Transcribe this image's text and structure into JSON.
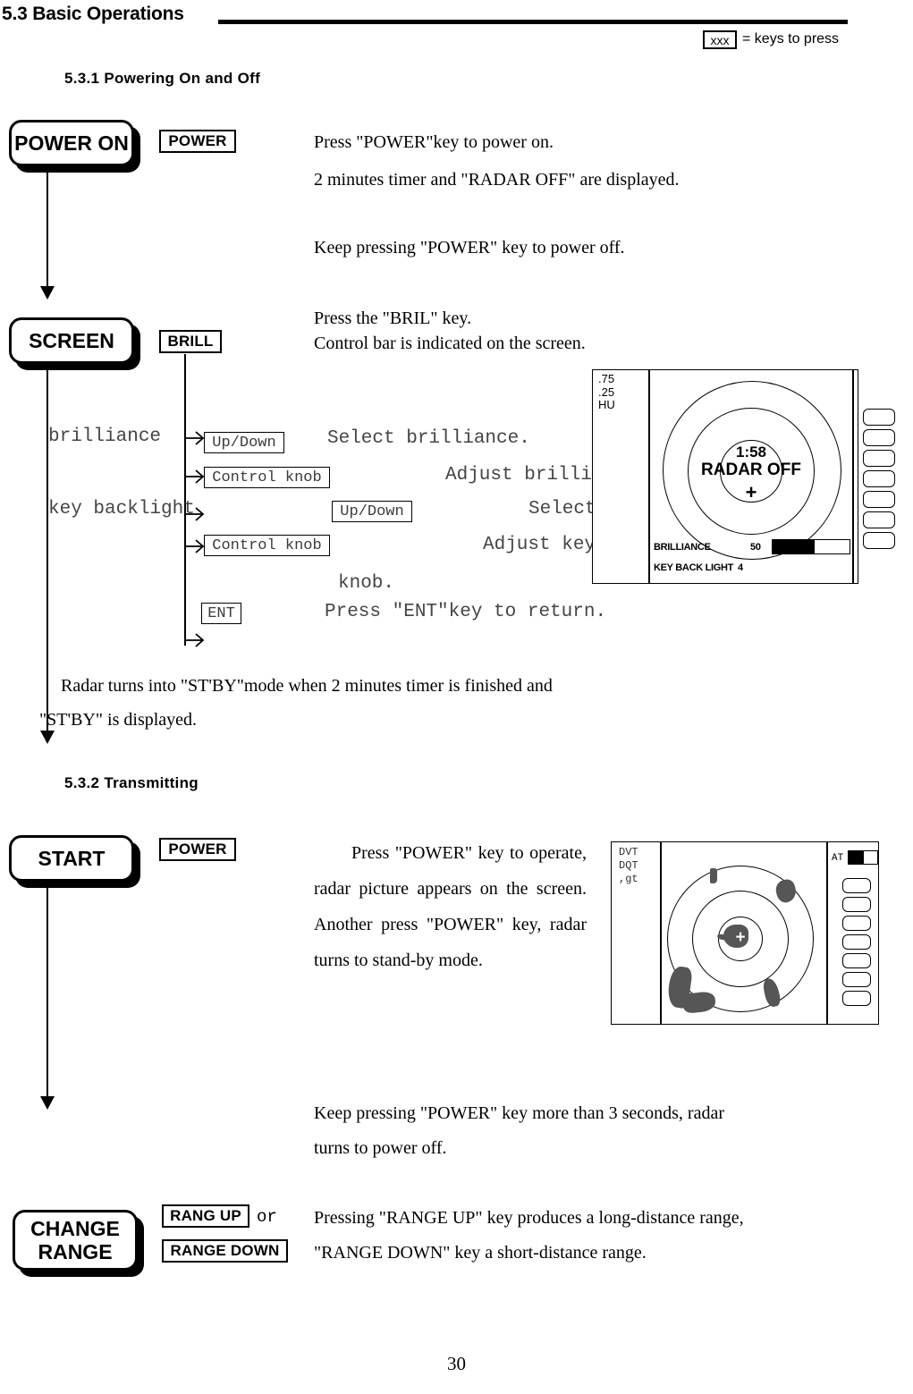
{
  "header": {
    "section_title": "5.3 Basic Operations",
    "legend_key": "xxx",
    "legend_text": "= keys to press"
  },
  "sections": [
    {
      "number_title": "5.3.1 Powering On and Off"
    },
    {
      "number_title": "5.3.2 Transmitting"
    }
  ],
  "flow": {
    "power_on": {
      "stage_label": "POWER ON",
      "key_label": "POWER",
      "lines": [
        "Press \"POWER\"key to power on.",
        "2 minutes timer and \"RADAR OFF\" are displayed.",
        "Keep pressing \"POWER\" key to power off."
      ]
    },
    "screen": {
      "stage_label": "SCREEN",
      "key_label": "BRILL",
      "lines": [
        "Press the \"BRIL\" key.",
        "Control bar is indicated on the screen."
      ],
      "tree": [
        {
          "item": "brilliance",
          "key": "Up/Down",
          "desc": "Select brilliance."
        },
        {
          "item": "",
          "key": "Control knob",
          "desc": "Adjust brilliance with"
        },
        {
          "item": "key backlight",
          "key": "Up/Down",
          "desc": "Select key backlight."
        },
        {
          "item": "",
          "key": "Control knob",
          "desc": "Adjust key backlight with"
        },
        {
          "item": "",
          "key": "",
          "desc": "knob."
        },
        {
          "item": "",
          "key": "ENT",
          "desc": "Press \"ENT\"key to return."
        }
      ],
      "note_lines": [
        "Radar turns into \"ST'BY\"mode when 2 minutes timer is finished and",
        "\"ST'BY\" is displayed."
      ]
    },
    "start": {
      "stage_label": "START",
      "key_label": "POWER",
      "paragraph": "Press \"POWER\" key to operate, radar picture appears on the screen. Another press \"POWER\" key, radar turns to stand-by mode.",
      "paragraph2_lines": [
        "Keep pressing \"POWER\" key more than 3 seconds, radar",
        "turns to power off."
      ]
    },
    "change_range": {
      "stage_label_line1": "CHANGE",
      "stage_label_line2": "RANGE",
      "key_up": "RANG UP",
      "conjunction": "or",
      "key_down": "RANGE DOWN",
      "lines": [
        "Pressing \"RANGE UP\" key produces a long-distance range,",
        "\"RANGE        DOWN\"   key   a   short-distance   range."
      ]
    }
  },
  "radar_off_display": {
    "corner_labels": [
      ".75",
      ".25",
      "HU"
    ],
    "timer": "1:58",
    "status": "RADAR OFF",
    "center_mark": "+",
    "brilliance_label": "BRILLIANCE",
    "brilliance_value": "50",
    "backlight_label": "KEY BACK LIGHT",
    "backlight_value": "4",
    "brilliance_bar_percent": 55,
    "softkey_count": 7
  },
  "radar_picture_display": {
    "corner_labels": [
      "DVT",
      "DQT",
      ",gt"
    ],
    "mode_label": "AT",
    "center_mark": "+",
    "ring_count": 3,
    "softkey_count": 7,
    "land_color": "#565656"
  },
  "page_number": "30"
}
